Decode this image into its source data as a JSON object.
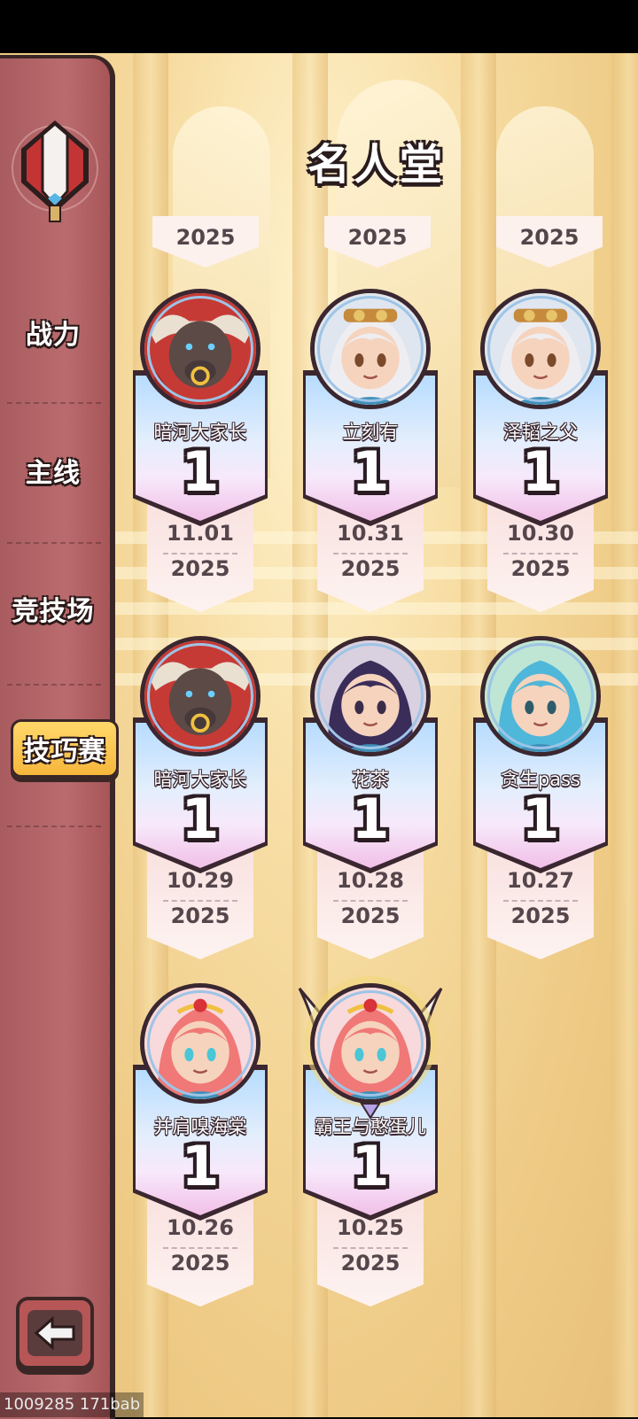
{
  "page": {
    "title": "名人堂"
  },
  "sidebar": {
    "items": [
      {
        "label": "战力"
      },
      {
        "label": "主线"
      },
      {
        "label": "竞技场"
      },
      {
        "label": "技巧赛",
        "active": true
      }
    ],
    "emblem_icon": "sword-shield-emblem-icon",
    "back_icon": "back-arrow-icon"
  },
  "top_partial_years": [
    "2025",
    "2025",
    "2025"
  ],
  "cards": [
    {
      "name": "暗河大家长",
      "rank": "1",
      "date": "11.01",
      "year": "2025",
      "avatar": "bull",
      "crest": false
    },
    {
      "name": "立刻有",
      "rank": "1",
      "date": "10.31",
      "year": "2025",
      "avatar": "white-hair",
      "crest": false
    },
    {
      "name": "泽韬之父",
      "rank": "1",
      "date": "10.30",
      "year": "2025",
      "avatar": "white-hair",
      "crest": false
    },
    {
      "name": "暗河大家长",
      "rank": "1",
      "date": "10.29",
      "year": "2025",
      "avatar": "bull",
      "crest": false
    },
    {
      "name": "花茶",
      "rank": "1",
      "date": "10.28",
      "year": "2025",
      "avatar": "dark-hair",
      "crest": false
    },
    {
      "name": "贪生pass",
      "rank": "1",
      "date": "10.27",
      "year": "2025",
      "avatar": "blue-hair",
      "crest": false
    },
    {
      "name": "并肩嗅海棠",
      "rank": "1",
      "date": "10.26",
      "year": "2025",
      "avatar": "pink-hair",
      "crest": false
    },
    {
      "name": "霸王与憨蛋儿",
      "rank": "1",
      "date": "10.25",
      "year": "2025",
      "avatar": "pink-hair",
      "crest": true
    }
  ],
  "watermark": "1009285 171bab",
  "colors": {
    "sidebar": "#b96b6d",
    "active_tab": "#f6b63c",
    "hall": "#f7dda3"
  }
}
